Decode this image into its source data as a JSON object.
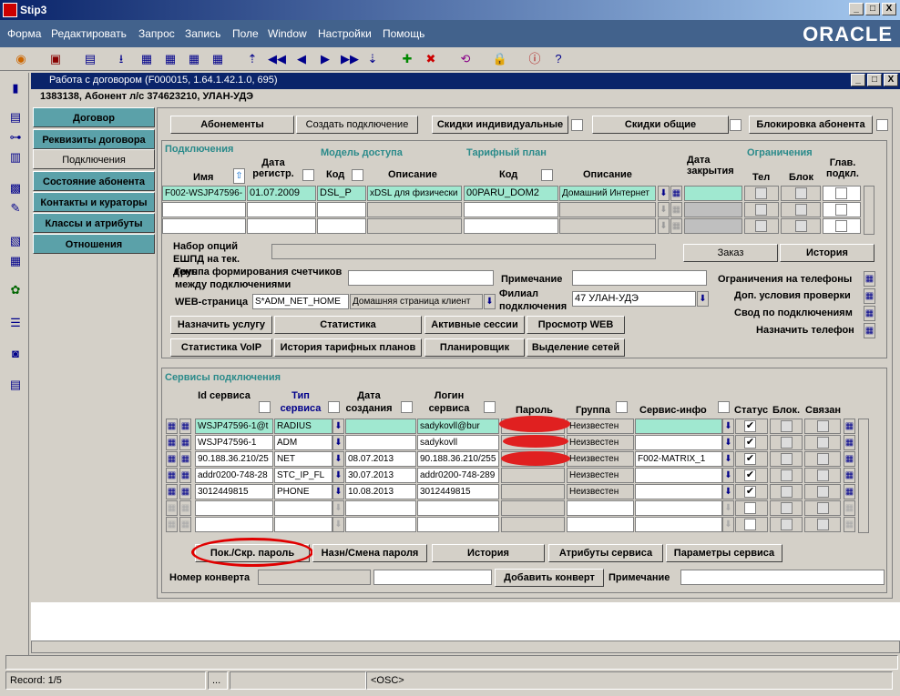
{
  "window": {
    "title": "Stip3",
    "min": "_",
    "max": "□",
    "close": "X"
  },
  "menu": [
    "Форма",
    "Редактировать",
    "Запрос",
    "Запись",
    "Поле",
    "Window",
    "Настройки",
    "Помощь"
  ],
  "brand": "ORACLE",
  "subwindow": {
    "title": "Работа с договором (F000015, 1.64.1.42.1.0, 695)",
    "min": "_",
    "max": "□",
    "close": "X"
  },
  "subscriber": "1383138, Абонент л/с 374623210, УЛАН-УДЭ",
  "nav_tabs": [
    "Договор",
    "Реквизиты договора",
    "Подключения",
    "Состояние абонента",
    "Контакты и кураторы",
    "Классы и атрибуты",
    "Отношения"
  ],
  "top_buttons": {
    "subscriptions": "Абонементы",
    "create": "Создать подключение",
    "disc_ind": "Скидки индивидуальные",
    "disc_common": "Скидки общие",
    "block": "Блокировка абонента"
  },
  "conn": {
    "section": "Подключения",
    "access": "Модель доступа",
    "tariff": "Тарифный план",
    "limits": "Ограничения",
    "h_name": "Имя",
    "h_date": "Дата регистр.",
    "h_code": "Код",
    "h_desc": "Описание",
    "h_tcode": "Код",
    "h_tdesc": "Описание",
    "h_close": "Дата закрытия",
    "h_tel": "Тел",
    "h_block": "Блок",
    "h_main": "Глав. подкл.",
    "row": {
      "name": "F002-WSJP47596-",
      "date": "01.07.2009",
      "code": "DSL_P",
      "desc": "xDSL для физически",
      "tcode": "00PARU_DOM2",
      "tdesc": "Домашний Интернет"
    }
  },
  "form": {
    "options_label": "Набор опций ЕШПД на тек. день",
    "counter_label": "Группа формирования счетчиков между подключениями",
    "web_label": "WEB-страница",
    "web_code": "S*ADM_NET_HOME",
    "web_desc": "Домашняя страница клиент",
    "note_label": "Примечание",
    "branch_label": "Филиал подключения",
    "branch": "47 УЛАН-УДЭ",
    "order": "Заказ",
    "history": "История",
    "phone_limits": "Ограничения на телефоны",
    "extra_check": "Доп. условия проверки",
    "summary": "Свод по подключениям",
    "assign_phone": "Назначить телефон"
  },
  "actions": [
    "Назначить услугу",
    "Статистика",
    "Активные сессии",
    "Просмотр WEB",
    "Статистика VoIP",
    "История тарифных планов",
    "Планировщик",
    "Выделение сетей"
  ],
  "services": {
    "section": "Сервисы подключения",
    "h_id": "Id сервиса",
    "h_type": "Тип сервиса",
    "h_created": "Дата создания",
    "h_login": "Логин сервиса",
    "h_pass": "Пароль",
    "h_group": "Группа",
    "h_info": "Сервис-инфо",
    "h_status": "Статус",
    "h_block": "Блок.",
    "h_linked": "Связан",
    "rows": [
      {
        "id": "WSJP47596-1@t",
        "type": "RADIUS",
        "date": "",
        "login": "sadykovll@bur",
        "group": "Неизвестен",
        "info": "",
        "status": "✔"
      },
      {
        "id": "WSJP47596-1",
        "type": "ADM",
        "date": "",
        "login": "sadykovll",
        "group": "Неизвестен",
        "info": "",
        "status": "✔"
      },
      {
        "id": "90.188.36.210/25",
        "type": "NET",
        "date": "08.07.2013",
        "login": "90.188.36.210/255",
        "group": "Неизвестен",
        "info": "F002-MATRIX_1",
        "status": "✔"
      },
      {
        "id": "addr0200-748-28",
        "type": "STC_IP_FL",
        "date": "30.07.2013",
        "login": "addr0200-748-289",
        "group": "Неизвестен",
        "info": "",
        "status": "✔"
      },
      {
        "id": "3012449815",
        "type": "PHONE",
        "date": "10.08.2013",
        "login": "3012449815",
        "group": "Неизвестен",
        "info": "",
        "status": "✔"
      }
    ],
    "btn_showpass": "Пок./Скр. пароль",
    "btn_setpass": "Назн/Смена пароля",
    "btn_history": "История",
    "btn_attrs": "Атрибуты сервиса",
    "btn_params": "Параметры сервиса",
    "envelope_label": "Номер конверта",
    "btn_envelope": "Добавить конверт",
    "note_label": "Примечание"
  },
  "status": {
    "record": "Record: 1/5",
    "dots": "...",
    "osc": "<OSC>"
  }
}
